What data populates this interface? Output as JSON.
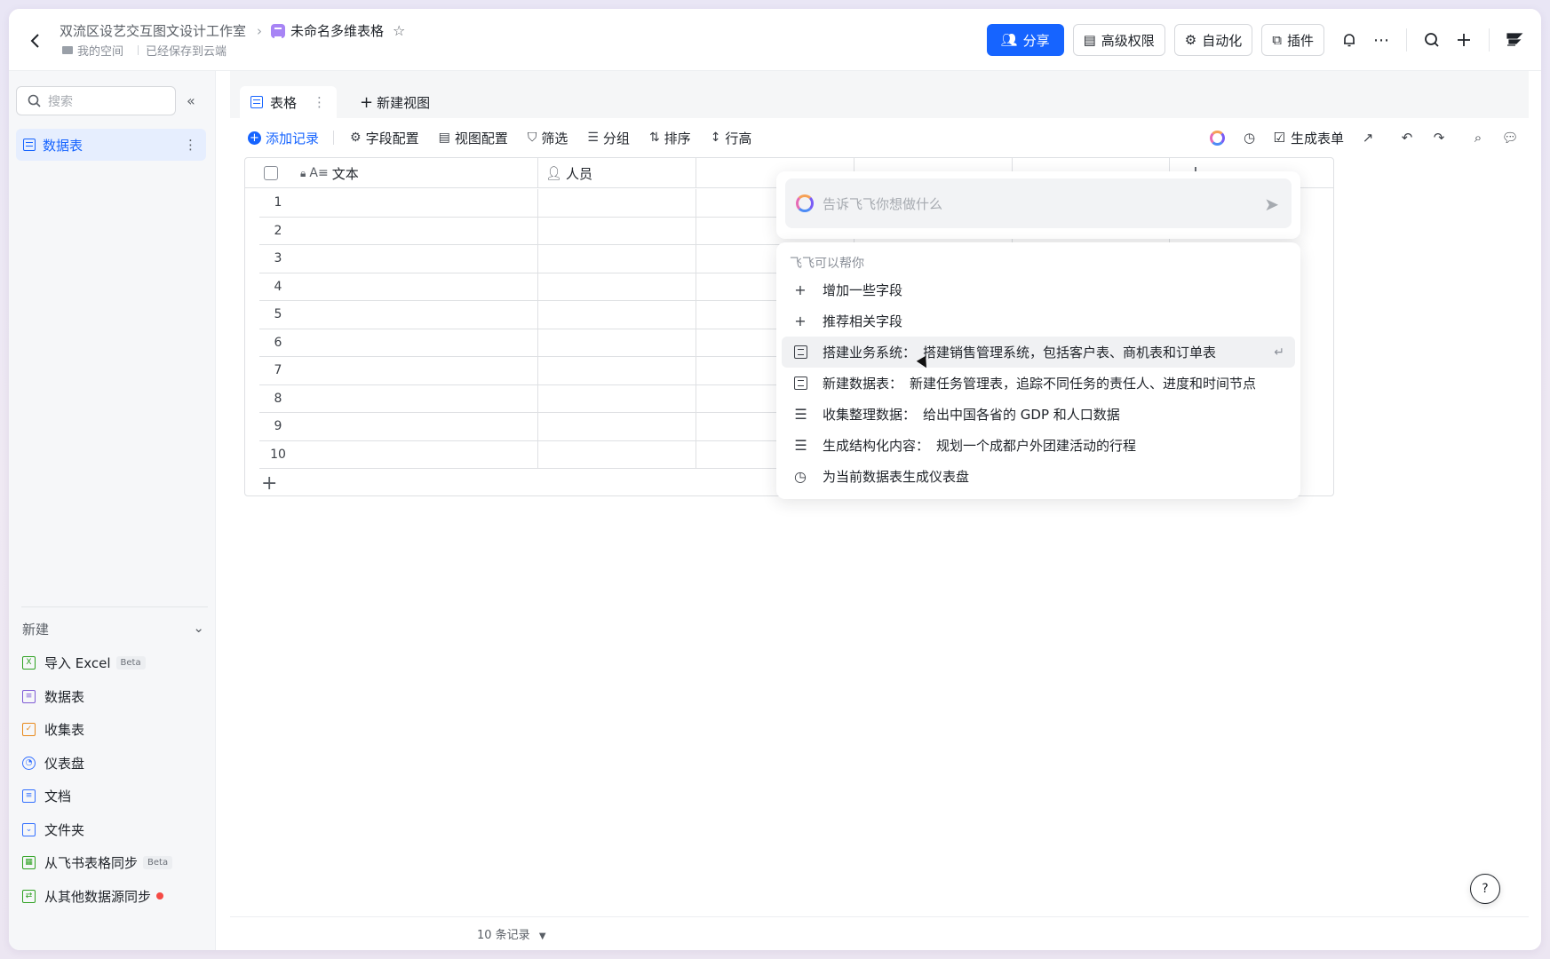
{
  "header": {
    "breadcrumb_workspace": "双流区设艺交互图文设计工作室",
    "doc_title": "未命名多维表格",
    "space_label": "我的空间",
    "save_status": "已经保存到云端",
    "share_label": "分享",
    "permission_label": "高级权限",
    "automation_label": "自动化",
    "plugin_label": "插件",
    "icons": [
      "back-icon",
      "star-icon",
      "bell-icon",
      "more-icon",
      "search-icon",
      "plus-icon",
      "app-logo-icon"
    ]
  },
  "sidebar": {
    "search_placeholder": "搜索",
    "active_item": "数据表",
    "new_section_label": "新建",
    "new_items": [
      {
        "label": "导入 Excel",
        "badge": "Beta",
        "color": "#2ea121"
      },
      {
        "label": "数据表",
        "badge": "",
        "color": "#7f5bd5"
      },
      {
        "label": "收集表",
        "badge": "",
        "color": "#e8891a"
      },
      {
        "label": "仪表盘",
        "badge": "",
        "color": "#3370ff"
      },
      {
        "label": "文档",
        "badge": "",
        "color": "#3370ff"
      },
      {
        "label": "文件夹",
        "badge": "",
        "color": "#3370ff"
      },
      {
        "label": "从飞书表格同步",
        "badge": "Beta",
        "color": "#2ea121"
      },
      {
        "label": "从其他数据源同步",
        "badge": "",
        "color": "#2ea121"
      }
    ]
  },
  "views": {
    "active_tab": "表格",
    "new_view_label": "新建视图"
  },
  "toolbar": {
    "add_record": "添加记录",
    "field_config": "字段配置",
    "view_config": "视图配置",
    "filter": "筛选",
    "group": "分组",
    "sort": "排序",
    "row_height": "行高",
    "generate_form": "生成表单"
  },
  "grid": {
    "columns": [
      "文本",
      "人员"
    ],
    "row_numbers": [
      "1",
      "2",
      "3",
      "4",
      "5",
      "6",
      "7",
      "8",
      "9",
      "10"
    ]
  },
  "footer": {
    "record_count": "10 条记录"
  },
  "ai_assistant": {
    "input_placeholder": "告诉飞飞你想做什么",
    "menu_title": "飞飞可以帮你",
    "items": [
      {
        "kind": "",
        "text": "增加一些字段",
        "icon": "plus-icon"
      },
      {
        "kind": "",
        "text": "推荐相关字段",
        "icon": "plus-icon"
      },
      {
        "kind": "搭建业务系统：",
        "text": "搭建销售管理系统，包括客户表、商机表和订单表",
        "icon": "table-icon"
      },
      {
        "kind": "新建数据表：",
        "text": "新建任务管理表，追踪不同任务的责任人、进度和时间节点",
        "icon": "table-icon"
      },
      {
        "kind": "收集整理数据：",
        "text": "给出中国各省的 GDP 和人口数据",
        "icon": "checklist-icon"
      },
      {
        "kind": "生成结构化内容：",
        "text": "规划一个成都户外团建活动的行程",
        "icon": "checklist-icon"
      },
      {
        "kind": "",
        "text": "为当前数据表生成仪表盘",
        "icon": "dashboard-icon"
      }
    ]
  },
  "colors": {
    "primary": "#1664ff",
    "active_nav_bg": "#e6eefe"
  }
}
